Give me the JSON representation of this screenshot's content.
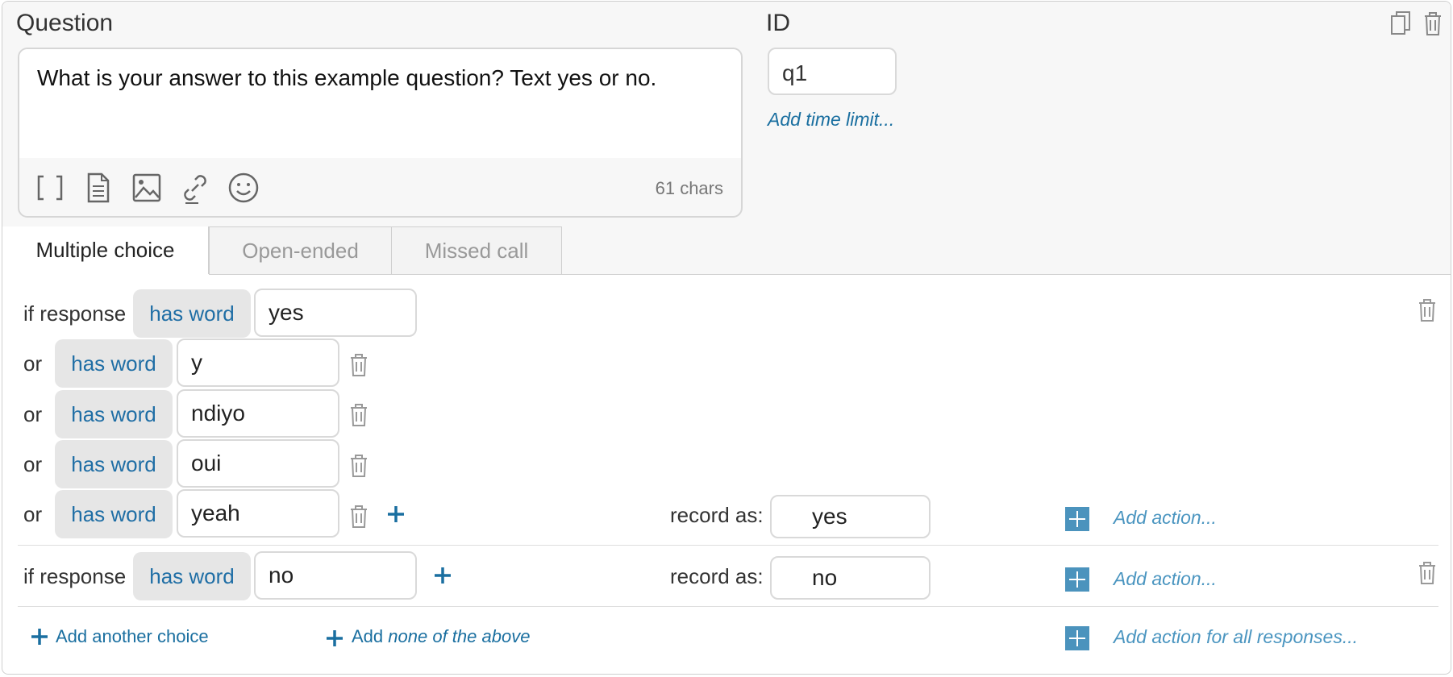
{
  "question": {
    "label": "Question",
    "text": "What is your answer to this example question? Text yes or no.",
    "char_count": "61 chars"
  },
  "id": {
    "label": "ID",
    "value": "q1",
    "time_limit_link": "Add time limit..."
  },
  "tabs": [
    {
      "label": "Multiple choice",
      "active": true
    },
    {
      "label": "Open-ended",
      "active": false
    },
    {
      "label": "Missed call",
      "active": false
    }
  ],
  "choices": [
    {
      "if_label": "if response",
      "operator": "has word",
      "words": [
        "yes",
        "y",
        "ndiyo",
        "oui",
        "yeah"
      ],
      "or_label": "or",
      "record_label": "record as:",
      "record_value": "yes",
      "add_action": "Add action..."
    },
    {
      "if_label": "if response",
      "operator": "has word",
      "words": [
        "no"
      ],
      "record_label": "record as:",
      "record_value": "no",
      "add_action": "Add action..."
    }
  ],
  "footer": {
    "add_choice": "Add another choice",
    "add_none_prefix": "Add",
    "add_none_italic": "none of the above",
    "add_action_all": "Add action for all responses..."
  },
  "colors": {
    "link_blue": "#1a6fa0",
    "action_blue": "#4a95c0",
    "pill_bg": "#e6e6e6"
  }
}
